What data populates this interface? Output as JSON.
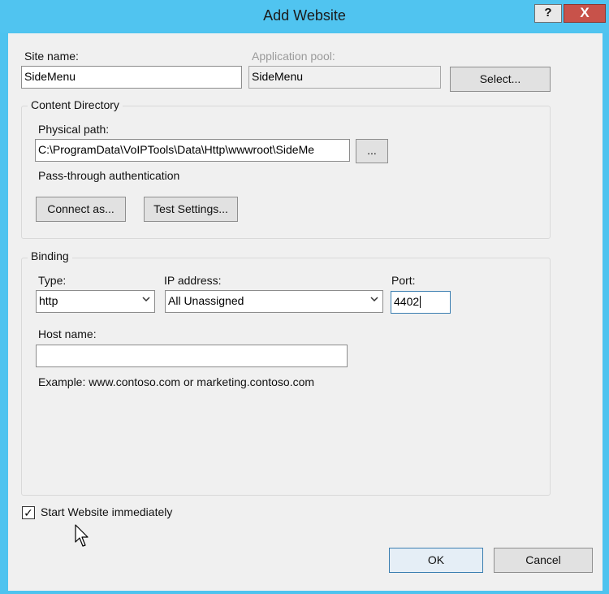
{
  "window": {
    "title": "Add Website",
    "help_label": "?",
    "close_label": "X"
  },
  "site": {
    "name_label": "Site name:",
    "name_value": "SideMenu",
    "pool_label": "Application pool:",
    "pool_value": "SideMenu",
    "select_label": "Select..."
  },
  "content_directory": {
    "title": "Content Directory",
    "physical_path_label": "Physical path:",
    "physical_path_value": "C:\\ProgramData\\VoIPTools\\Data\\Http\\wwwroot\\SideMe",
    "browse_label": "...",
    "passthrough_label": "Pass-through authentication",
    "connect_as_label": "Connect as...",
    "test_settings_label": "Test Settings..."
  },
  "binding": {
    "title": "Binding",
    "type_label": "Type:",
    "type_value": "http",
    "ip_label": "IP address:",
    "ip_value": "All Unassigned",
    "port_label": "Port:",
    "port_value": "4402",
    "host_label": "Host name:",
    "host_value": "",
    "example_text": "Example: www.contoso.com or marketing.contoso.com"
  },
  "start_immediately": {
    "label": "Start Website immediately",
    "checked": true,
    "check_glyph": "✓"
  },
  "footer": {
    "ok_label": "OK",
    "cancel_label": "Cancel"
  },
  "colors": {
    "titlebar": "#50c4f0",
    "close_button": "#c8524a",
    "dialog_background": "#f0f0f0"
  }
}
